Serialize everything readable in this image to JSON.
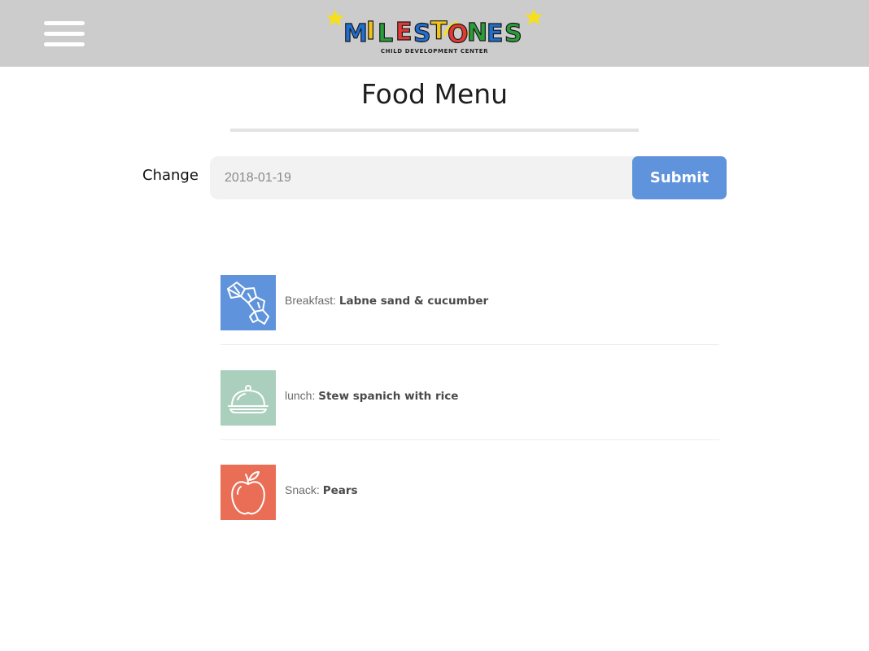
{
  "header": {
    "menu_icon": "hamburger-menu-icon",
    "logo_text": "MILESTONES",
    "logo_subtitle": "CHILD DEVELOPMENT CENTER",
    "background_color": "#cccccc"
  },
  "page": {
    "title": "Food Menu"
  },
  "date_form": {
    "label": "Change",
    "date_value": "2018-01-19",
    "submit_label": "Submit",
    "accent_color": "#5f93dc"
  },
  "meals": [
    {
      "meal": "Breakfast",
      "separator": ": ",
      "item": "Labne sand & cucumber",
      "icon": "croissant-icon",
      "color": "#5f93dc"
    },
    {
      "meal": "lunch",
      "separator": ": ",
      "item": "Stew spanich with rice",
      "icon": "cloche-icon",
      "color": "#aacfbd"
    },
    {
      "meal": "Snack",
      "separator": ": ",
      "item": "Pears",
      "icon": "apple-icon",
      "color": "#ea6d56"
    }
  ]
}
